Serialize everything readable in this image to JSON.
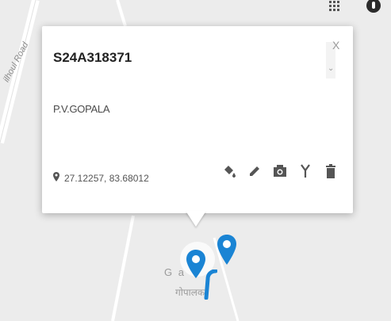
{
  "map": {
    "road_label": "ilhoul Road",
    "place_latin": "G        a",
    "place_native": "गोपालक"
  },
  "header": {
    "apps_icon": "apps-grid-icon",
    "account_icon": "account-icon"
  },
  "popup": {
    "title": "S24A318371",
    "name": "P.V.GOPALA",
    "coordinates": "27.12257, 83.68012",
    "close_label": "X",
    "scroll_down_label": "⌄",
    "actions": [
      {
        "icon": "paint-bucket-icon"
      },
      {
        "icon": "pencil-icon"
      },
      {
        "icon": "camera-icon"
      },
      {
        "icon": "fork-icon"
      },
      {
        "icon": "trash-icon"
      }
    ]
  },
  "colors": {
    "pin": "#1a84d4",
    "map_bg": "#ececec",
    "road": "#ffffff",
    "icon": "#555555"
  }
}
